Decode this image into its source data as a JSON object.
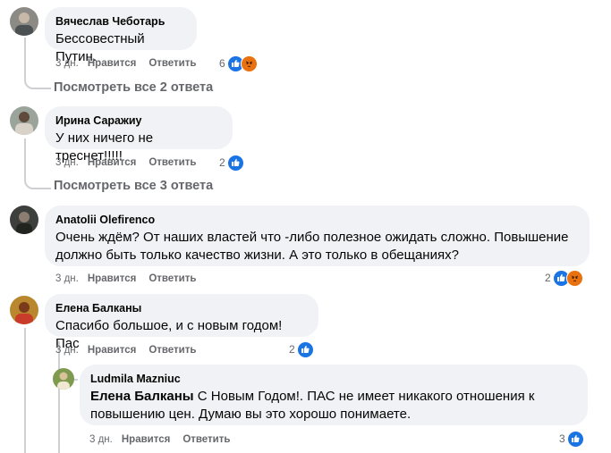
{
  "comments": [
    {
      "author": "Вячеслав Чеботарь",
      "text": "Бессовестный Путин.",
      "time": "3 дн.",
      "like": "Нравится",
      "reply": "Ответить",
      "reaction_count": "6",
      "reactions": [
        "like-icon",
        "angry-icon"
      ],
      "view_replies": "Посмотреть все 2 ответа"
    },
    {
      "author": "Ирина Саражиу",
      "text": "У них ничего не треснет!!!!!",
      "time": "3 дн.",
      "like": "Нравится",
      "reply": "Ответить",
      "reaction_count": "2",
      "reactions": [
        "like-icon"
      ],
      "view_replies": "Посмотреть все 3 ответа"
    },
    {
      "author": "Anatolii Olefirenco",
      "text": "Очень ждём? От наших властей что -либо полезное ожидать сложно. Повышение должно быть только качество жизни. А это только в обещаниях?",
      "time": "3 дн.",
      "like": "Нравится",
      "reply": "Ответить",
      "reaction_count": "2",
      "reactions": [
        "like-icon",
        "angry-icon"
      ]
    },
    {
      "author": "Елена Балканы",
      "text": "Спасибо большое, и с новым годом! Пас",
      "time": "3 дн.",
      "like": "Нравится",
      "reply": "Ответить",
      "reaction_count": "2",
      "reactions": [
        "like-icon"
      ]
    }
  ],
  "reply": {
    "author": "Ludmila Mazniuc",
    "mention": "Елена Балканы",
    "text": " С Новым Годом!. ПАС не имеет никакого отношения к повышению цен. Думаю вы это хорошо понимаете.",
    "time": "3 дн.",
    "like": "Нравится",
    "reply": "Ответить",
    "reaction_count": "3",
    "reactions": [
      "like-icon"
    ]
  },
  "colors": {
    "like": "#1b74e4",
    "angry": "#e9710f",
    "bubble": "#f0f2f5",
    "meta": "#65676b"
  }
}
